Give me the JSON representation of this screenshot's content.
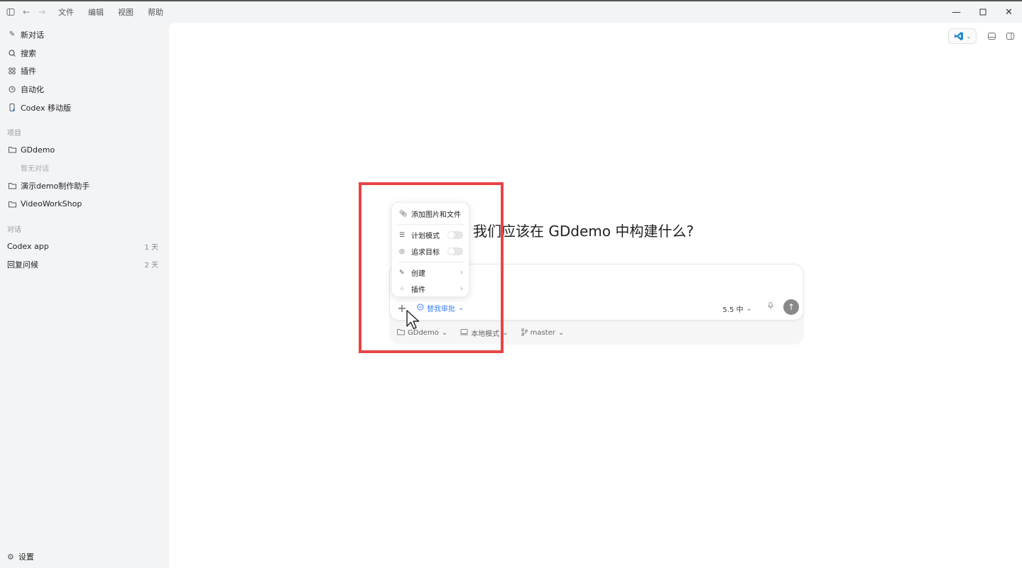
{
  "titlebar": {
    "menu": [
      "文件",
      "编辑",
      "视图",
      "帮助"
    ],
    "icons": [
      "sidebar-toggle-icon",
      "back-arrow-icon",
      "forward-arrow-icon"
    ],
    "window_controls": [
      "minimize-icon",
      "maximize-icon",
      "close-icon"
    ]
  },
  "sidebar": {
    "nav": [
      {
        "label": "新对话",
        "icon": "edit-icon"
      },
      {
        "label": "搜索",
        "icon": "search-icon"
      },
      {
        "label": "插件",
        "icon": "grid-icon"
      },
      {
        "label": "自动化",
        "icon": "clock-icon"
      },
      {
        "label": "Codex 移动版",
        "icon": "phone-icon"
      }
    ],
    "projects_label": "项目",
    "projects": [
      {
        "label": "GDdemo",
        "icon": "folder-icon"
      },
      {
        "label": "演示demo制作助手",
        "icon": "folder-icon"
      },
      {
        "label": "VideoWorkShop",
        "icon": "folder-icon"
      }
    ],
    "empty_note": "暂无对话",
    "conversations_label": "对话",
    "conversations": [
      {
        "title": "Codex app",
        "age": "1 天"
      },
      {
        "title": "回复问候",
        "age": "2 天"
      }
    ],
    "settings_label": "设置"
  },
  "main": {
    "headline": "我们应该在 GDdemo 中构建什么?",
    "composer": {
      "approval_label": "替我审批",
      "model_label": "5.5 中",
      "footer": {
        "project": "GDdemo",
        "mode": "本地模式",
        "branch": "master"
      }
    },
    "popup": {
      "add_files": "添加图片和文件",
      "plan_mode": "计划模式",
      "pursue_goal": "追求目标",
      "create": "创建",
      "plugins": "插件"
    }
  },
  "colors": {
    "accent": "#3b82f6",
    "highlight": "#e84545",
    "vscode": "#1f8ad2"
  }
}
